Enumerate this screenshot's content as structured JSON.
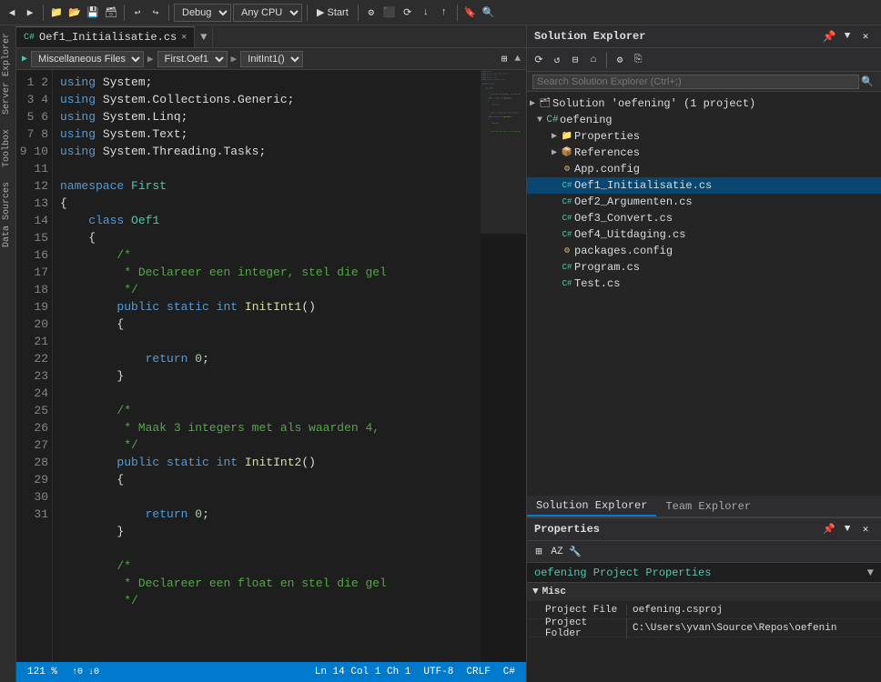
{
  "toolbar": {
    "debug_label": "Debug",
    "cpu_label": "Any CPU",
    "start_label": "▶ Start",
    "debug_dropdown": "Debug",
    "cpu_dropdown": "Any CPU"
  },
  "tabs": [
    {
      "label": "Oef1_Initialisatie.cs",
      "active": true
    },
    {
      "label": "+",
      "active": false
    }
  ],
  "filepath": {
    "project": "Miscellaneous Files",
    "namespace": "First.Oef1",
    "method": "InitInt1()"
  },
  "code_lines": [
    {
      "num": "1",
      "html": "<span class='kw'>using</span> System;"
    },
    {
      "num": "2",
      "html": "<span class='kw'>using</span> System.Collections.Generic;"
    },
    {
      "num": "3",
      "html": "<span class='kw'>using</span> System.Linq;"
    },
    {
      "num": "4",
      "html": "<span class='kw'>using</span> System.Text;"
    },
    {
      "num": "5",
      "html": "<span class='kw'>using</span> System.Threading.Tasks;"
    },
    {
      "num": "6",
      "html": ""
    },
    {
      "num": "7",
      "html": "<span class='kw'>namespace</span> <span class='ns'>First</span>"
    },
    {
      "num": "8",
      "html": "{"
    },
    {
      "num": "9",
      "html": "    <span class='kw'>class</span> <span class='ns'>Oef1</span>"
    },
    {
      "num": "10",
      "html": "    {"
    },
    {
      "num": "11",
      "html": "        <span class='comment'>/*</span>"
    },
    {
      "num": "12",
      "html": "        <span class='comment'> * Declareer een integer, stel die gel</span>"
    },
    {
      "num": "13",
      "html": "        <span class='comment'> */</span>"
    },
    {
      "num": "14",
      "html": "        <span class='kw'>public</span> <span class='kw'>static</span> <span class='kw'>int</span> <span class='method'>InitInt1</span>()"
    },
    {
      "num": "15",
      "html": "        {"
    },
    {
      "num": "16",
      "html": ""
    },
    {
      "num": "17",
      "html": "            <span class='kw'>return</span> <span class='num'>0</span>;"
    },
    {
      "num": "18",
      "html": "        }"
    },
    {
      "num": "19",
      "html": ""
    },
    {
      "num": "20",
      "html": "        <span class='comment'>/*</span>"
    },
    {
      "num": "21",
      "html": "        <span class='comment'> * Maak 3 integers met als waarden 4,</span>"
    },
    {
      "num": "22",
      "html": "        <span class='comment'> */</span>"
    },
    {
      "num": "23",
      "html": "        <span class='kw'>public</span> <span class='kw'>static</span> <span class='kw'>int</span> <span class='method'>InitInt2</span>()"
    },
    {
      "num": "24",
      "html": "        {"
    },
    {
      "num": "25",
      "html": ""
    },
    {
      "num": "26",
      "html": "            <span class='kw'>return</span> <span class='num'>0</span>;"
    },
    {
      "num": "27",
      "html": "        }"
    },
    {
      "num": "28",
      "html": ""
    },
    {
      "num": "29",
      "html": "        <span class='comment'>/*</span>"
    },
    {
      "num": "30",
      "html": "        <span class='comment'> * Declareer een float en stel die gel</span>"
    },
    {
      "num": "31",
      "html": "        <span class='comment'> */</span>"
    }
  ],
  "side_labels": [
    "Server Explorer",
    "Toolbox",
    "Data Sources"
  ],
  "solution_explorer": {
    "title": "Solution Explorer",
    "search_placeholder": "Search Solution Explorer (Ctrl+;)",
    "solution_label": "Solution 'oefening' (1 project)",
    "project_label": "oefening",
    "items": [
      {
        "label": "Properties",
        "indent": 4,
        "icon": "folder",
        "expandable": true
      },
      {
        "label": "References",
        "indent": 4,
        "icon": "refs",
        "expandable": true
      },
      {
        "label": "App.config",
        "indent": 4,
        "icon": "config"
      },
      {
        "label": "Oef1_Initialisatie.cs",
        "indent": 4,
        "icon": "cs",
        "selected": true
      },
      {
        "label": "Oef2_Argumenten.cs",
        "indent": 4,
        "icon": "cs"
      },
      {
        "label": "Oef3_Convert.cs",
        "indent": 4,
        "icon": "cs"
      },
      {
        "label": "Oef4_Uitdaging.cs",
        "indent": 4,
        "icon": "cs"
      },
      {
        "label": "packages.config",
        "indent": 4,
        "icon": "config"
      },
      {
        "label": "Program.cs",
        "indent": 4,
        "icon": "cs"
      },
      {
        "label": "Test.cs",
        "indent": 4,
        "icon": "cs"
      }
    ]
  },
  "bottom_tabs": [
    {
      "label": "Solution Explorer",
      "active": true
    },
    {
      "label": "Team Explorer",
      "active": false
    }
  ],
  "properties": {
    "title": "Properties",
    "subject": "oefening  Project Properties",
    "sections": [
      {
        "label": "Misc",
        "rows": [
          {
            "key": "Project File",
            "value": "oefening.csproj"
          },
          {
            "key": "Project Folder",
            "value": "C:\\Users\\yvan\\Source\\Repos\\oefenin"
          }
        ]
      }
    ]
  },
  "status_bar": {
    "zoom": "121 %",
    "position": "",
    "encoding": "",
    "line_endings": ""
  }
}
